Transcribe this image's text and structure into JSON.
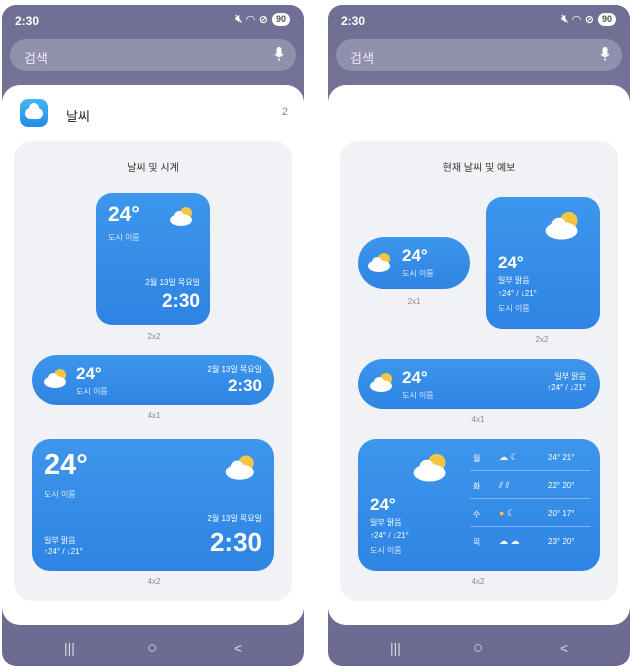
{
  "status": {
    "time": "2:30",
    "battery": "90"
  },
  "search": {
    "placeholder": "검색"
  },
  "app": {
    "name": "날씨",
    "count": "2"
  },
  "left": {
    "section_title": "날씨 및 시계",
    "w2x2": {
      "temp": "24°",
      "city": "도시 이름",
      "date": "2월 13일 목요일",
      "time": "2:30",
      "size": "2x2"
    },
    "w4x1": {
      "temp": "24°",
      "city": "도시 이름",
      "date": "2월 13일 목요일",
      "time": "2:30",
      "size": "4x1"
    },
    "w4x2": {
      "temp": "24°",
      "city": "도시 이름",
      "condition": "일부 맑음",
      "hilo": "↑24° / ↓21°",
      "date": "2월 13일 목요일",
      "time": "2:30",
      "size": "4x2"
    }
  },
  "right": {
    "section_title": "현재 날씨 및 예보",
    "w2x1": {
      "temp": "24°",
      "city": "도시 이름",
      "size": "2x1"
    },
    "w2x2": {
      "temp": "24°",
      "condition": "일부 맑음",
      "hilo": "↑24° / ↓21°",
      "city": "도시 이름",
      "size": "2x2"
    },
    "w4x1": {
      "temp": "24°",
      "city": "도시 이름",
      "condition": "일부 맑음",
      "hilo": "↑24° / ↓21°",
      "size": "4x1"
    },
    "w4x2": {
      "temp": "24°",
      "condition": "일부 맑음",
      "hilo": "↑24° / ↓21°",
      "city": "도시 이름",
      "size": "4x2",
      "forecast": [
        {
          "day": "월",
          "temps": "24° 21°"
        },
        {
          "day": "화",
          "temps": "22° 20°"
        },
        {
          "day": "수",
          "temps": "20° 17°"
        },
        {
          "day": "목",
          "temps": "23° 20°"
        }
      ]
    }
  },
  "nav": {
    "recents": "|||",
    "home": "○",
    "back": "<"
  }
}
